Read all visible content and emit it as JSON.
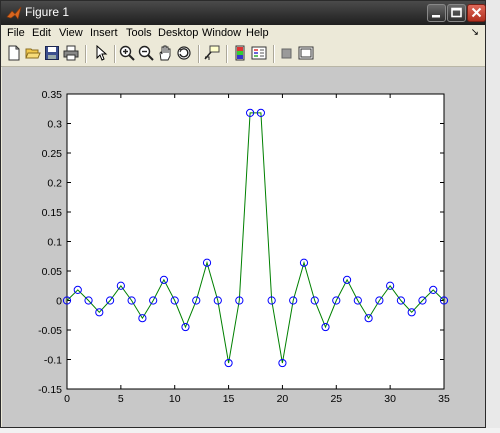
{
  "window": {
    "title": "Figure 1",
    "icons": {
      "app": "matlab-logo-icon",
      "minimize": "minimize-icon",
      "maximize": "maximize-icon",
      "close": "close-icon"
    }
  },
  "menubar": {
    "items": [
      "File",
      "Edit",
      "View",
      "Insert",
      "Tools",
      "Desktop",
      "Window",
      "Help"
    ],
    "dock_arrow_icon": "dock-arrow-icon"
  },
  "toolbar": {
    "buttons": [
      "new-figure-icon",
      "open-file-icon",
      "save-icon",
      "print-icon",
      "edit-plot-arrow-icon",
      "zoom-in-icon",
      "zoom-out-icon",
      "pan-hand-icon",
      "rotate-3d-icon",
      "data-cursor-icon",
      "insert-colorbar-icon",
      "insert-legend-icon",
      "hide-plot-tools-icon",
      "show-plot-tools-icon"
    ]
  },
  "colors": {
    "line": "#008000",
    "marker": "#0000ff",
    "figure_bg": "#c8c8c8",
    "axes_bg": "#ffffff"
  },
  "chart_data": {
    "type": "line",
    "title": "",
    "xlabel": "",
    "ylabel": "",
    "xlim": [
      0,
      35
    ],
    "ylim": [
      -0.15,
      0.35
    ],
    "xticks": [
      0,
      5,
      10,
      15,
      20,
      25,
      30,
      35
    ],
    "yticks": [
      -0.15,
      -0.1,
      -0.05,
      0,
      0.05,
      0.1,
      0.15,
      0.2,
      0.25,
      0.3,
      0.35
    ],
    "xtick_labels": [
      "0",
      "5",
      "10",
      "15",
      "20",
      "25",
      "30",
      "35"
    ],
    "ytick_labels": [
      "-0.15",
      "-0.1",
      "-0.05",
      "0",
      "0.05",
      "0.1",
      "0.15",
      "0.2",
      "0.25",
      "0.3",
      "0.35"
    ],
    "grid": false,
    "series": [
      {
        "style": "line-with-circle-markers",
        "line_color": "#008000",
        "marker_color": "#0000ff",
        "x": [
          0,
          1,
          2,
          3,
          4,
          5,
          6,
          7,
          8,
          9,
          10,
          11,
          12,
          13,
          14,
          15,
          16,
          17,
          18,
          19,
          20,
          21,
          22,
          23,
          24,
          25,
          26,
          27,
          28,
          29,
          30,
          31,
          32,
          33,
          34,
          35
        ],
        "y": [
          0,
          0.018,
          0,
          -0.02,
          0,
          0.025,
          0,
          -0.03,
          0,
          0.035,
          0,
          -0.045,
          0,
          0.064,
          0,
          -0.106,
          0,
          0.318,
          0.318,
          0,
          -0.106,
          0,
          0.064,
          0,
          -0.045,
          0,
          0.035,
          0,
          -0.03,
          0,
          0.025,
          0,
          -0.02,
          0,
          0.018,
          0
        ]
      }
    ]
  }
}
